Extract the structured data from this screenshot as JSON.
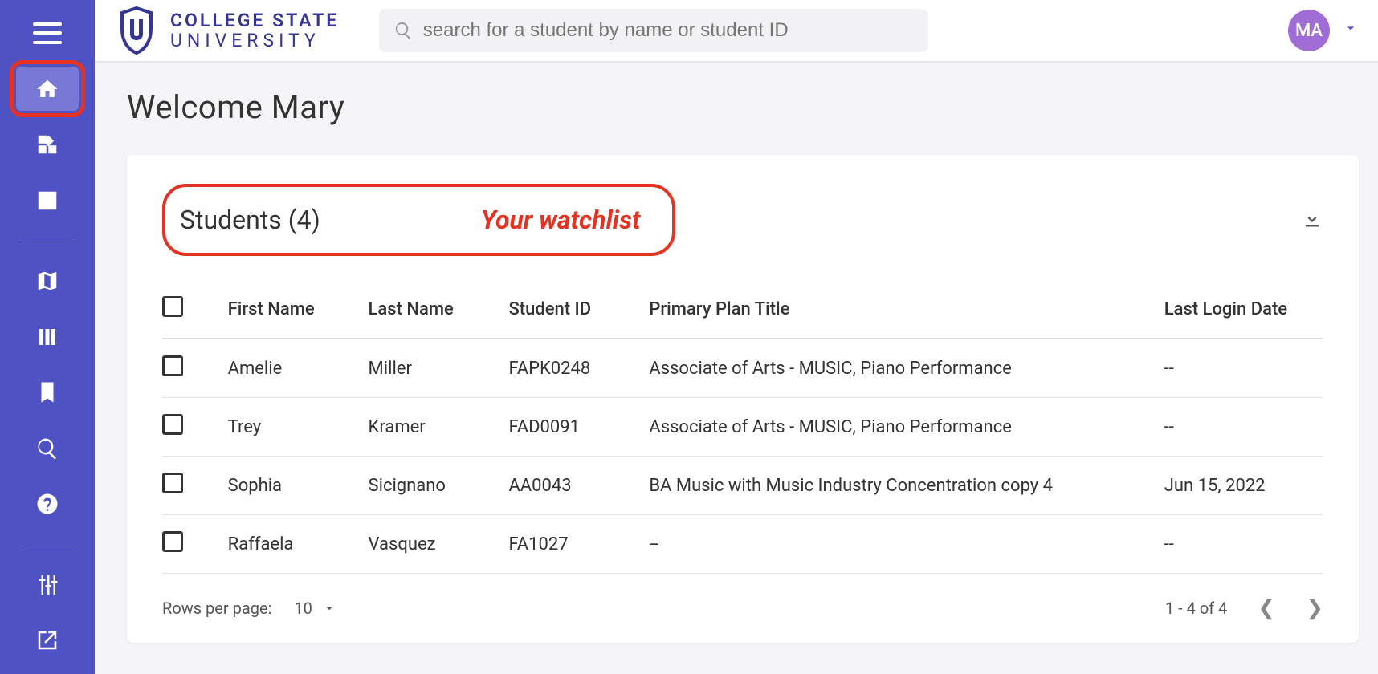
{
  "branding": {
    "line1": "COLLEGE STATE",
    "line2": "UNIVERSITY"
  },
  "search": {
    "placeholder": "search for a student by name or student ID"
  },
  "user": {
    "initials": "MA"
  },
  "page": {
    "title": "Welcome Mary"
  },
  "watchlist": {
    "heading": "Students (4)",
    "annotation": "Your watchlist",
    "columns": {
      "first": "First Name",
      "last": "Last Name",
      "id": "Student ID",
      "plan": "Primary Plan Title",
      "login": "Last Login Date"
    },
    "rows": [
      {
        "first": "Amelie",
        "last": "Miller",
        "id": "FAPK0248",
        "plan": "Associate of Arts - MUSIC, Piano Performance",
        "login": "--"
      },
      {
        "first": "Trey",
        "last": "Kramer",
        "id": "FAD0091",
        "plan": "Associate of Arts - MUSIC, Piano Performance",
        "login": "--"
      },
      {
        "first": "Sophia",
        "last": "Sicignano",
        "id": "AA0043",
        "plan": "BA Music with Music Industry Concentration copy 4",
        "login": "Jun 15, 2022"
      },
      {
        "first": "Raffaela",
        "last": "Vasquez",
        "id": "FA1027",
        "plan": "--",
        "login": "--"
      }
    ]
  },
  "pager": {
    "rows_label": "Rows per page:",
    "rows_value": "10",
    "range": "1 - 4 of 4"
  }
}
